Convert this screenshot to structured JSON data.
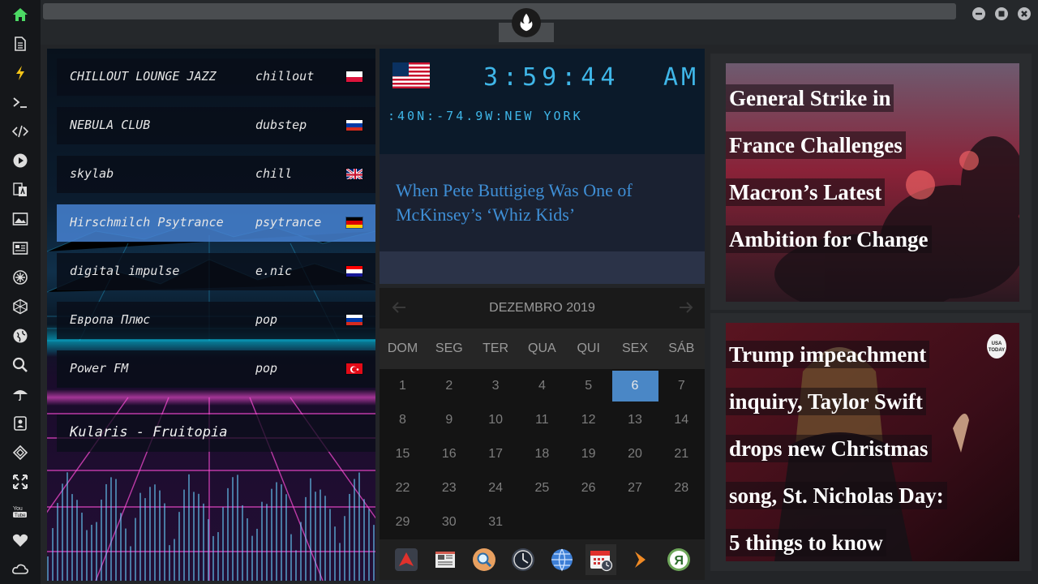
{
  "sidebar": {
    "items": [
      "home-icon",
      "document-icon",
      "lightning-icon",
      "terminal-icon",
      "code-icon",
      "play-icon",
      "translate-icon",
      "image-icon",
      "news-icon",
      "settings-icon",
      "hexagon-icon",
      "globe-icon",
      "search-icon",
      "umbrella-icon",
      "contact-icon",
      "diamond-icon",
      "expand-icon",
      "youtube-icon",
      "heart-icon",
      "cloud-icon"
    ]
  },
  "radio": {
    "stations": [
      {
        "name": "CHILLOUT LOUNGE JAZZ",
        "genre": "chillout",
        "flag": [
          "#ffffff",
          "#dc143c"
        ]
      },
      {
        "name": "NEBULA CLUB",
        "genre": "dubstep",
        "flag": [
          "#ffffff",
          "#0039a6",
          "#d52b1e"
        ]
      },
      {
        "name": "skylab",
        "genre": "chill",
        "flag": [
          "#012169"
        ]
      },
      {
        "name": "Hirschmilch Psytrance",
        "genre": "psytrance",
        "flag": [
          "#000000",
          "#dd0000",
          "#ffce00"
        ]
      },
      {
        "name": "digital impulse",
        "genre": "e.nic",
        "flag": [
          "#ff0000",
          "#ffffff",
          "#171796"
        ]
      },
      {
        "name": "Европа Плюс",
        "genre": "pop",
        "flag": [
          "#ffffff",
          "#0039a6",
          "#d52b1e"
        ]
      },
      {
        "name": "Power FM",
        "genre": "pop",
        "flag": [
          "#e30a17"
        ]
      }
    ],
    "active_index": 3,
    "now_playing": "Kularis - Fruitopia"
  },
  "clock": {
    "time": "3:59:44",
    "ampm": "AM",
    "location": ":40N:-74.9W:NEW YORK"
  },
  "headline": {
    "text": "When Pete Buttigieg Was One of McKinsey’s ‘Whiz Kids’"
  },
  "calendar": {
    "month": "DEZEMBRO 2019",
    "weekdays": [
      "DOM",
      "SEG",
      "TER",
      "QUA",
      "QUI",
      "SEX",
      "SÁB"
    ],
    "selected_day": 6,
    "days": [
      "1",
      "2",
      "3",
      "4",
      "5",
      "6",
      "7",
      "8",
      "9",
      "10",
      "11",
      "12",
      "13",
      "14",
      "15",
      "16",
      "17",
      "18",
      "19",
      "20",
      "21",
      "22",
      "23",
      "24",
      "25",
      "26",
      "27",
      "28",
      "29",
      "30",
      "31"
    ]
  },
  "dock": {
    "items": [
      "app-launcher-icon",
      "news-reader-icon",
      "search-icon",
      "clock-icon",
      "browser-icon",
      "calendar-icon",
      "media-icon",
      "yandex-icon"
    ],
    "active_index": 5
  },
  "news": [
    {
      "title_lines": [
        "General Strike in",
        "France Challenges",
        "Macron’s Latest",
        "Ambition for Change"
      ]
    },
    {
      "title_lines": [
        "Trump impeachment",
        "inquiry, Taylor Swift",
        "drops new Christmas",
        "song, St. Nicholas Day:",
        "5 things to know"
      ],
      "badge": "USA TODAY"
    }
  ]
}
